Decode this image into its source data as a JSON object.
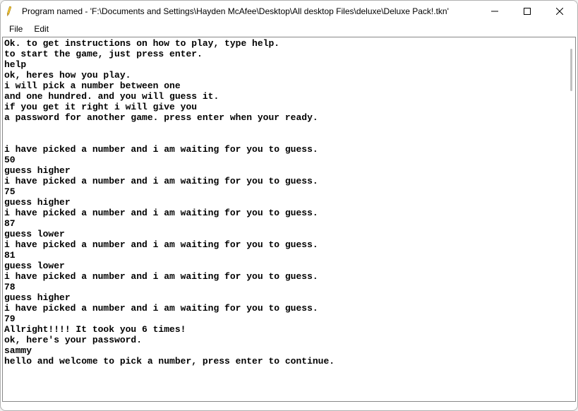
{
  "window": {
    "title": "Program named - 'F:\\Documents and Settings\\Hayden McAfee\\Desktop\\All desktop Files\\deluxe\\Deluxe Pack!.tkn'",
    "app_icon": "✏️"
  },
  "menu": {
    "file": "File",
    "edit": "Edit"
  },
  "content": {
    "text": "Ok. to get instructions on how to play, type help.\nto start the game, just press enter.\nhelp\nok, heres how you play.\ni will pick a number between one\nand one hundred. and you will guess it.\nif you get it right i will give you\na password for another game. press enter when your ready.\n\n\ni have picked a number and i am waiting for you to guess.\n50\nguess higher\ni have picked a number and i am waiting for you to guess.\n75\nguess higher\ni have picked a number and i am waiting for you to guess.\n87\nguess lower\ni have picked a number and i am waiting for you to guess.\n81\nguess lower\ni have picked a number and i am waiting for you to guess.\n78\nguess higher\ni have picked a number and i am waiting for you to guess.\n79\nAllright!!!! It took you 6 times!\nok, here's your password.\nsammy\nhello and welcome to pick a number, press enter to continue."
  }
}
